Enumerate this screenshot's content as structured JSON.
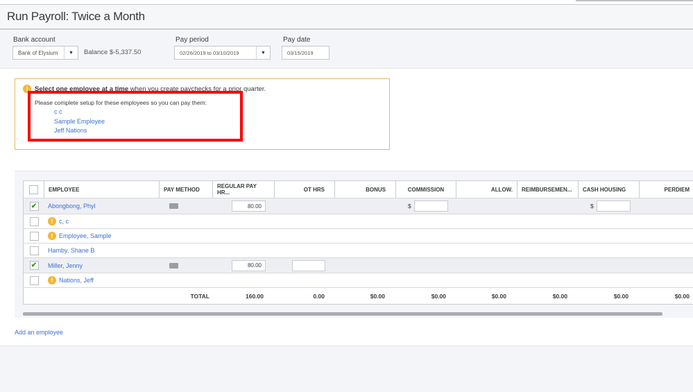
{
  "header": {
    "title": "Run Payroll: Twice a Month"
  },
  "bank": {
    "label": "Bank account",
    "value": "Bank of Elysium",
    "balance": "Balance $-5,337.50"
  },
  "pay_period": {
    "label": "Pay period",
    "value": "02/26/2019 to 03/10/2019"
  },
  "pay_date": {
    "label": "Pay date",
    "value": "03/15/2019"
  },
  "warning": {
    "bold": "Select one employee at a time",
    "rest": " when you create paychecks for a prior quarter.",
    "setup": "Please complete setup for these employees so you can pay them:",
    "employees": [
      "c c",
      "Sample Employee",
      "Jeff Nations"
    ]
  },
  "table": {
    "headers": [
      "EMPLOYEE",
      "PAY METHOD",
      "REGULAR PAY HR...",
      "OT HRS",
      "BONUS",
      "COMMISSION",
      "ALLOW.",
      "REIMBURSEMEN...",
      "CASH HOUSING",
      "PERDIEM"
    ],
    "rows": [
      {
        "name": "Abongbong, Phyl",
        "checked": true,
        "warning": false,
        "reg": "80.00"
      },
      {
        "name": "c, c",
        "checked": false,
        "warning": true
      },
      {
        "name": "Employee, Sample",
        "checked": false,
        "warning": true
      },
      {
        "name": "Hamby, Shane B",
        "checked": false,
        "warning": false
      },
      {
        "name": "Miller, Jenny",
        "checked": true,
        "warning": false,
        "reg": "80.00"
      },
      {
        "name": "Nations, Jeff",
        "checked": false,
        "warning": true
      }
    ],
    "currency_symbol": "$",
    "total": {
      "label": "TOTAL",
      "reg": "160.00",
      "ot": "0.00",
      "bonus": "$0.00",
      "commission": "$0.00",
      "allow": "$0.00",
      "reimb": "$0.00",
      "cash": "$0.00",
      "perdiem": "$0.00"
    }
  },
  "add_employee": "Add an employee",
  "colors": {
    "link": "#3b6fd6",
    "warning": "#f2b632",
    "check": "#2ca01c",
    "highlight": "#ff0000"
  }
}
